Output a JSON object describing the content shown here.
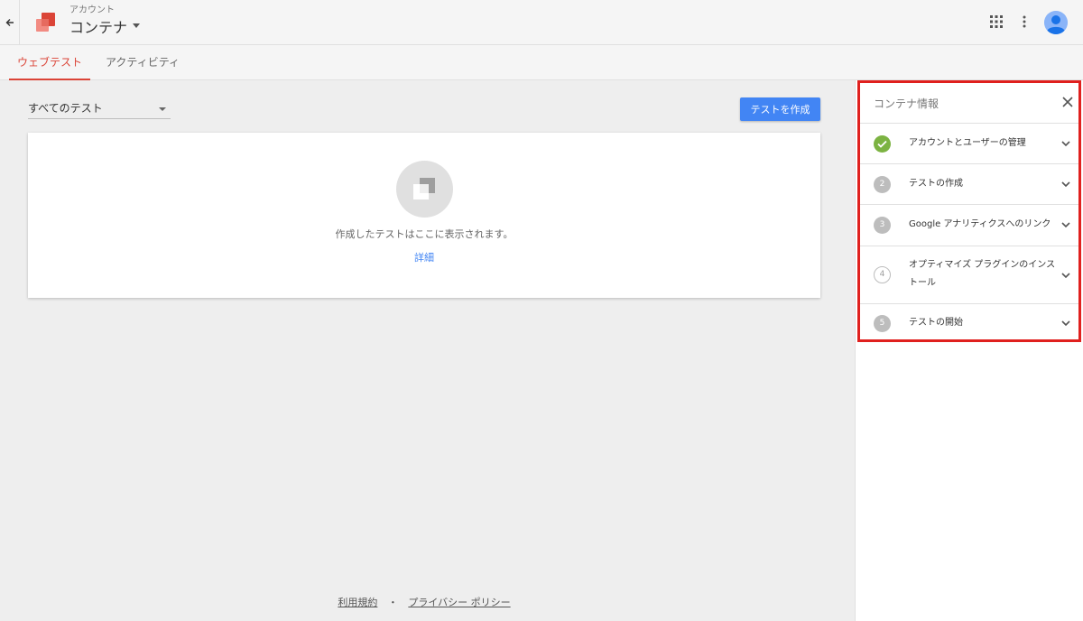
{
  "header": {
    "account_label": "アカウント",
    "container_name": "コンテナ"
  },
  "tabs": [
    {
      "label": "ウェブテスト",
      "active": true
    },
    {
      "label": "アクティビティ",
      "active": false
    }
  ],
  "main": {
    "filter_value": "すべてのテスト",
    "create_button": "テストを作成",
    "empty_message": "作成したテストはここに表示されます。",
    "details_link": "詳細"
  },
  "footer": {
    "terms": "利用規約",
    "separator": "・",
    "privacy": "プライバシー ポリシー"
  },
  "side_panel": {
    "title": "コンテナ情報",
    "steps": [
      {
        "number": "",
        "label": "アカウントとユーザーの管理",
        "state": "done"
      },
      {
        "number": "2",
        "label": "テストの作成",
        "state": "pending"
      },
      {
        "number": "3",
        "label": "Google アナリティクスへのリンク",
        "state": "pending"
      },
      {
        "number": "4",
        "label": "オプティマイズ プラグインのインストール",
        "state": "outline"
      },
      {
        "number": "5",
        "label": "テストの開始",
        "state": "pending"
      }
    ]
  },
  "colors": {
    "accent_tab": "#db4437",
    "primary_button": "#4285f4",
    "done_green": "#7cb342",
    "highlight_border": "#e0201e"
  },
  "icons": [
    "back-arrow-icon",
    "optimize-logo-icon",
    "apps-grid-icon",
    "more-vert-icon",
    "avatar-icon",
    "empty-state-icon",
    "close-icon",
    "check-icon",
    "chevron-down-icon"
  ]
}
